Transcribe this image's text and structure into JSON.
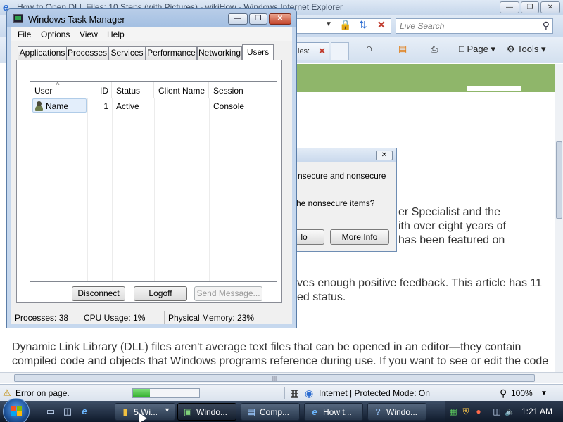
{
  "browser": {
    "title": "How to Open DLL Files: 10 Steps (with Pictures) - wikiHow - Windows Internet Explorer",
    "search_placeholder": "Live Search",
    "tab_label": "les:",
    "commands": {
      "page": "Page",
      "tools": "Tools"
    },
    "paragraphs": [
      "er Specialist and the",
      "ith over eight years of",
      "has been featured on",
      "ves enough positive feedback. This article has 11",
      "ed status.",
      "Dynamic Link Library (DLL) files aren't average text files that can be opened in an editor—they contain",
      "compiled code and objects that Windows programs reference during use. If you want to see or edit the code"
    ],
    "status": {
      "message": "Error on page.",
      "progress": 0.25,
      "zone": "Internet | Protected Mode: On",
      "zoom": "100%"
    }
  },
  "security_dialog": {
    "line1": "nsecure and nonsecure",
    "line2": "he nonsecure items?",
    "no_label": "lo",
    "more_info_label": "More Info"
  },
  "task_manager": {
    "title": "Windows Task Manager",
    "menu": [
      "File",
      "Options",
      "View",
      "Help"
    ],
    "tabs": [
      "Applications",
      "Processes",
      "Services",
      "Performance",
      "Networking",
      "Users"
    ],
    "active_tab": "Users",
    "columns": [
      "User",
      "ID",
      "Status",
      "Client Name",
      "Session"
    ],
    "rows": [
      {
        "user": "Name",
        "id": "1",
        "status": "Active",
        "client": "",
        "session": "Console"
      }
    ],
    "buttons": {
      "disconnect": "Disconnect",
      "logoff": "Logoff",
      "send_message": "Send Message..."
    },
    "status": {
      "processes": "Processes: 38",
      "cpu": "CPU Usage: 1%",
      "memory": "Physical Memory: 23%"
    }
  },
  "taskbar": {
    "buttons": [
      {
        "label": "5 Wi...",
        "icon": "folder-icon"
      },
      {
        "label": "Windo...",
        "icon": "task-manager-icon"
      },
      {
        "label": "Comp...",
        "icon": "computer-icon"
      },
      {
        "label": "How t...",
        "icon": "ie-icon"
      },
      {
        "label": "Windo...",
        "icon": "help-icon"
      }
    ],
    "clock": "1:21 AM"
  }
}
